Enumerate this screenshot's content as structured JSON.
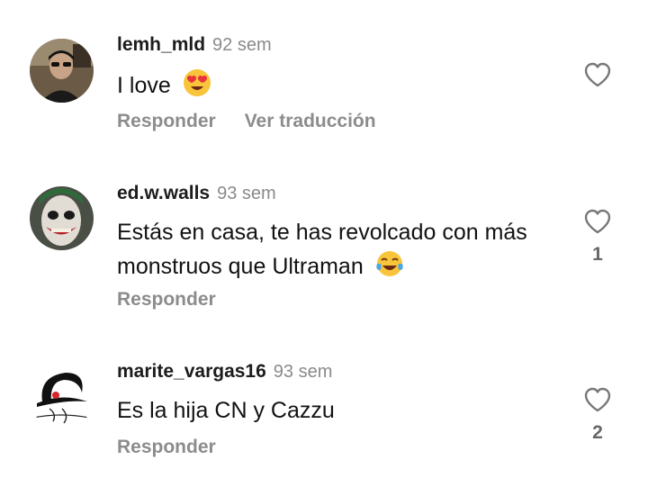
{
  "comments": [
    {
      "username": "lemh_mld",
      "time": "92 sem",
      "text": "I love",
      "emoji": "heart-eyes-emoji",
      "actions": {
        "reply": "Responder",
        "translate": "Ver traducción"
      },
      "likes": ""
    },
    {
      "username": "ed.w.walls",
      "time": "93 sem",
      "text": "Estás en casa, te has revolcado con más monstruos que Ultraman",
      "emoji": "tears-of-joy-emoji",
      "actions": {
        "reply": "Responder"
      },
      "likes": "1"
    },
    {
      "username": "marite_vargas16",
      "time": "93 sem",
      "text": "Es la hija CN y Cazzu",
      "actions": {
        "reply": "Responder"
      },
      "likes": "2"
    }
  ],
  "colors": {
    "username": "#1c1c1c",
    "secondary": "#8a8a8a",
    "emoji_yellow": "#f8c43a",
    "heart_red": "#e8333c"
  }
}
